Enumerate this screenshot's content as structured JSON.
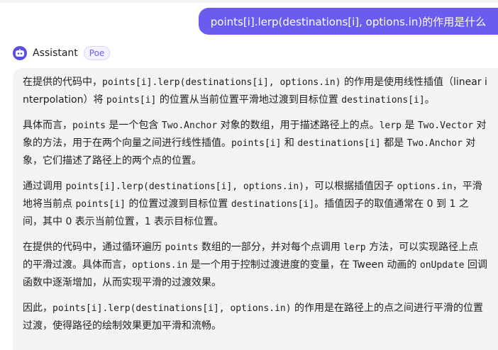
{
  "user_message": "points[i].lerp(destinations[i], options.in)的作用是什么",
  "assistant": {
    "name": "Assistant",
    "badge": "Poe"
  },
  "answer": {
    "p1": {
      "t1": "在提供的代码中，",
      "c1": "points[i].lerp(destinations[i], options.in)",
      "t2": " 的作用是使用线性插值（linear interpolation）将 ",
      "c2": "points[i]",
      "t3": " 的位置从当前位置平滑地过渡到目标位置 ",
      "c3": "destinations[i]",
      "t4": "。"
    },
    "p2": {
      "t1": "具体而言，",
      "c1": "points",
      "t2": " 是一个包含 ",
      "c2": "Two.Anchor",
      "t3": " 对象的数组，用于描述路径上的点。",
      "c3": "lerp",
      "t4": " 是 ",
      "c4": "Two.Vector",
      "t5": " 对象的方法，用于在两个向量之间进行线性插值。",
      "c5": "points[i]",
      "t6": " 和 ",
      "c6": "destinations[i]",
      "t7": " 都是 ",
      "c7": "Two.Anchor",
      "t8": " 对象，它们描述了路径上的两个点的位置。"
    },
    "p3": {
      "t1": "通过调用 ",
      "c1": "points[i].lerp(destinations[i], options.in)",
      "t2": "，可以根据插值因子 ",
      "c2": "options.in",
      "t3": "，平滑地将当前点 ",
      "c3": "points[i]",
      "t4": " 的位置过渡到目标位置 ",
      "c4": "destinations[i]",
      "t5": "。插值因子的取值通常在 0 到 1 之间，其中 0 表示当前位置，1 表示目标位置。"
    },
    "p4": {
      "t1": "在提供的代码中，通过循环遍历 ",
      "c1": "points",
      "t2": " 数组的一部分，并对每个点调用 ",
      "c2": "lerp",
      "t3": " 方法，可以实现路径上点的平滑过渡。具体而言，",
      "c3": "options.in",
      "t4": " 是一个用于控制过渡进度的变量，在 Tween 动画的 ",
      "c4": "onUpdate",
      "t5": " 回调函数中逐渐增加，从而实现平滑的过渡效果。"
    },
    "p5": {
      "t1": "因此，",
      "c1": "points[i].lerp(destinations[i], options.in)",
      "t2": " 的作用是在路径上的点之间进行平滑的位置过渡，使得路径的绘制效果更加平滑和流畅。"
    }
  },
  "colors": {
    "user_bubble": "#6b5cf0",
    "card_background": "#f3f3f6",
    "bot_avatar": "#5b4fe0"
  },
  "icons": {
    "bot_avatar": "bot-avatar-icon"
  }
}
